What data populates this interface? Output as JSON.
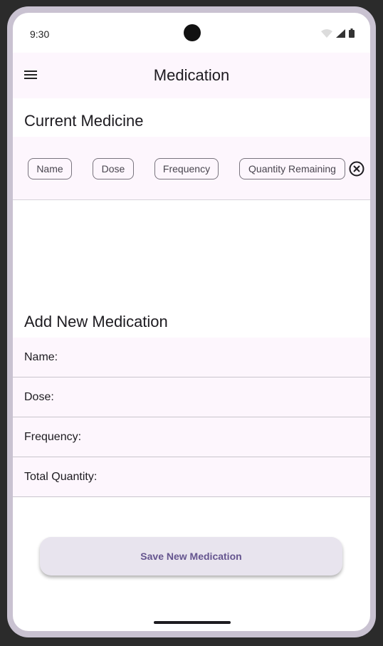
{
  "status_bar": {
    "time": "9:30"
  },
  "app_bar": {
    "title": "Medication"
  },
  "current_section": {
    "title": "Current Medicine",
    "columns": [
      "Name",
      "Dose",
      "Frequency",
      "Quantity Remaining"
    ]
  },
  "add_section": {
    "title": "Add New Medication",
    "fields": [
      {
        "label": "Name:",
        "value": ""
      },
      {
        "label": "Dose:",
        "value": ""
      },
      {
        "label": "Frequency:",
        "value": ""
      },
      {
        "label": "Total Quantity:",
        "value": ""
      }
    ]
  },
  "save_button": {
    "label": "Save New Medication"
  },
  "colors": {
    "surface": "#fdf6fd",
    "primary": "#65558f",
    "button_bg": "#e8e4ee"
  }
}
